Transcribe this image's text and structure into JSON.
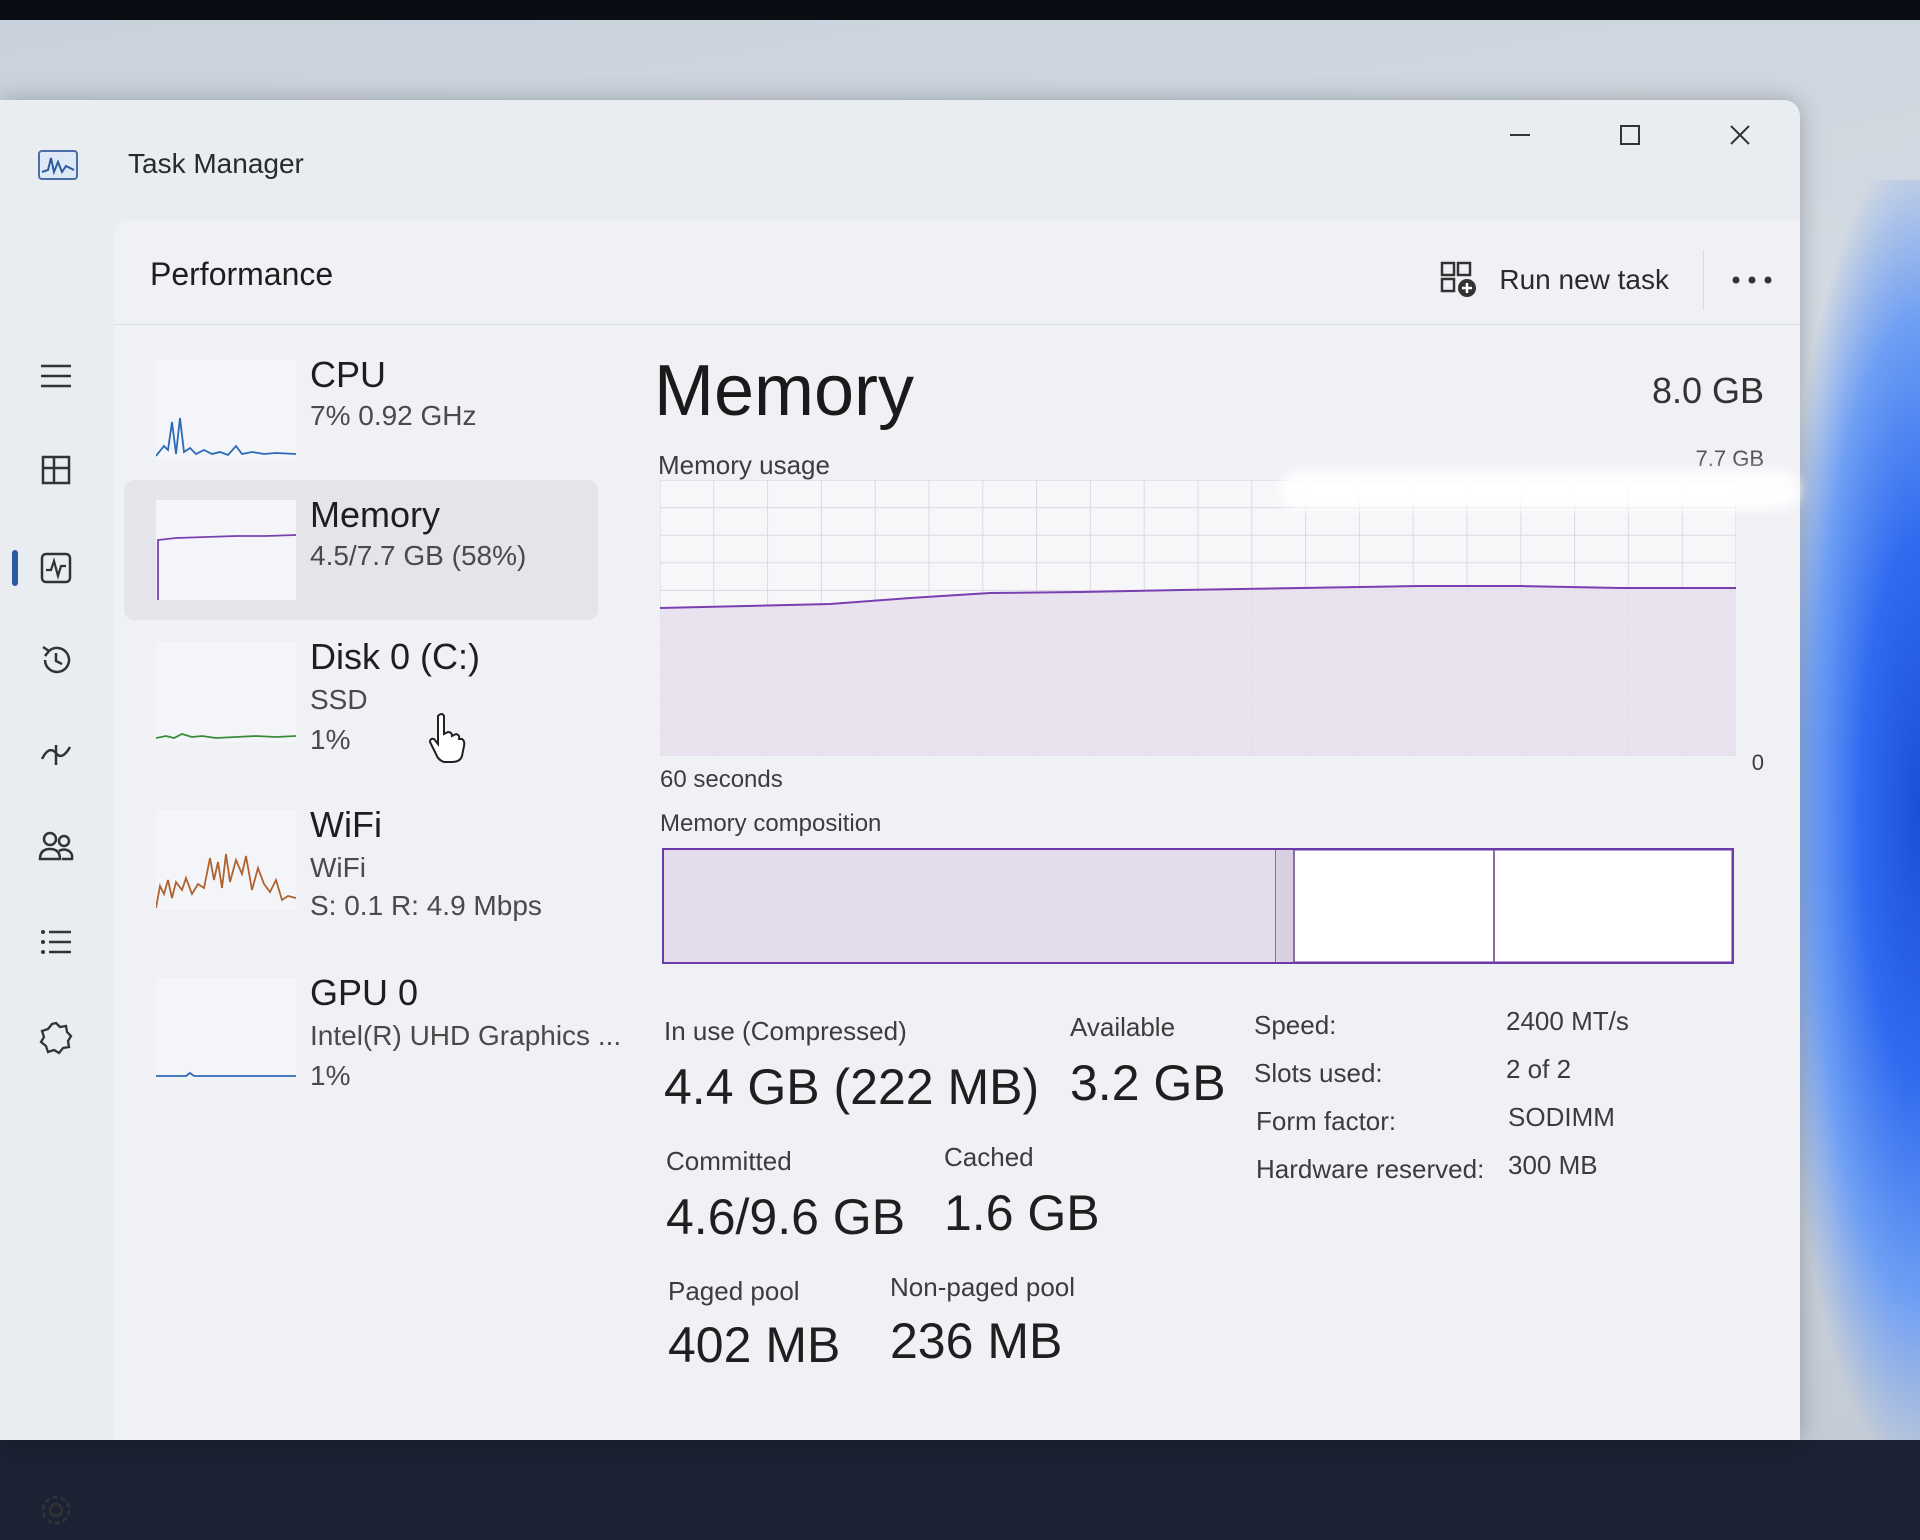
{
  "window": {
    "title": "Task Manager"
  },
  "page": {
    "title": "Performance"
  },
  "toolbar": {
    "run_new_task": "Run new task"
  },
  "sidebar": {
    "items": [
      {
        "name": "menu-icon"
      },
      {
        "name": "processes-icon"
      },
      {
        "name": "performance-icon"
      },
      {
        "name": "app-history-icon"
      },
      {
        "name": "startup-apps-icon"
      },
      {
        "name": "users-icon"
      },
      {
        "name": "details-icon"
      },
      {
        "name": "services-icon"
      },
      {
        "name": "settings-icon"
      }
    ]
  },
  "perf_items": [
    {
      "title": "CPU",
      "line1": "7%  0.92 GHz"
    },
    {
      "title": "Memory",
      "line1": "4.5/7.7 GB (58%)"
    },
    {
      "title": "Disk 0 (C:)",
      "line1": "SSD",
      "line2": "1%"
    },
    {
      "title": "WiFi",
      "line1": "WiFi",
      "line2": "S: 0.1  R: 4.9 Mbps"
    },
    {
      "title": "GPU 0",
      "line1": "Intel(R) UHD Graphics ...",
      "line2": "1%"
    }
  ],
  "detail": {
    "title": "Memory",
    "total": "8.0 GB",
    "usage_label": "Memory usage",
    "usage_max": "7.7 GB",
    "time_label": "60 seconds",
    "zero_label": "0",
    "composition_label": "Memory composition",
    "in_use_label": "In use (Compressed)",
    "in_use_value": "4.4 GB (222 MB)",
    "available_label": "Available",
    "available_value": "3.2 GB",
    "committed_label": "Committed",
    "committed_value": "4.6/9.6 GB",
    "cached_label": "Cached",
    "cached_value": "1.6 GB",
    "paged_label": "Paged pool",
    "paged_value": "402 MB",
    "nonpaged_label": "Non-paged pool",
    "nonpaged_value": "236 MB",
    "specs": [
      {
        "label": "Speed:",
        "value": "2400 MT/s"
      },
      {
        "label": "Slots used:",
        "value": "2 of 2"
      },
      {
        "label": "Form factor:",
        "value": "SODIMM"
      },
      {
        "label": "Hardware reserved:",
        "value": "300 MB"
      }
    ]
  },
  "colors": {
    "memory_accent": "#7a3fb0",
    "memory_fill": "#e4dcea",
    "nav_indicator": "#2c5aa0"
  }
}
